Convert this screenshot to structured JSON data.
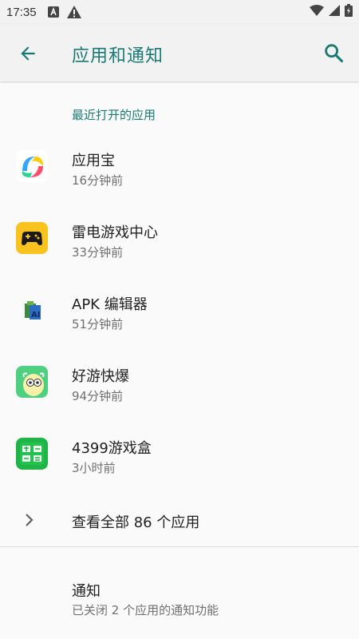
{
  "status_bar": {
    "time": "17:35",
    "icons": [
      "a-notification-icon",
      "warning-icon",
      "wifi-icon",
      "signal-icon",
      "battery-icon"
    ]
  },
  "app_bar": {
    "title": "应用和通知",
    "back_icon": "arrow-back-icon",
    "search_icon": "search-icon"
  },
  "recent": {
    "header": "最近打开的应用",
    "apps": [
      {
        "name": "应用宝",
        "time": "16分钟前",
        "icon": "yingyongbao-icon"
      },
      {
        "name": "雷电游戏中心",
        "time": "33分钟前",
        "icon": "gamepad-icon"
      },
      {
        "name": "APK 编辑器",
        "time": "51分钟前",
        "icon": "apk-editor-icon"
      },
      {
        "name": "好游快爆",
        "time": "94分钟前",
        "icon": "haoyou-icon"
      },
      {
        "name": "4399游戏盒",
        "time": "3小时前",
        "icon": "game-box-icon"
      }
    ]
  },
  "see_all": {
    "label": "查看全部 86 个应用"
  },
  "notifications": {
    "title": "通知",
    "summary": "已关闭 2 个应用的通知功能"
  },
  "colors": {
    "accent": "#1a7a73",
    "background": "#fafafa",
    "appbar": "#f2f2f2"
  }
}
